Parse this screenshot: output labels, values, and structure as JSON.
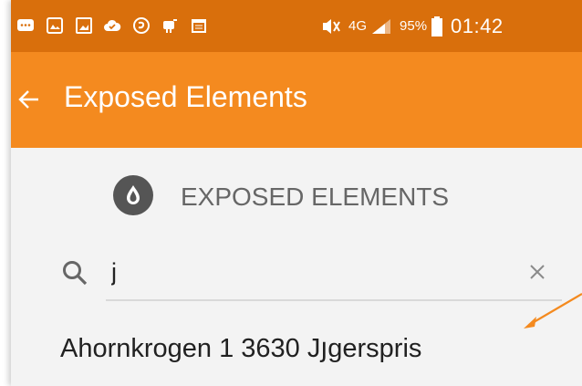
{
  "status_bar": {
    "network": "4G",
    "battery": "95%",
    "time": "01:42",
    "icons": [
      "chat-icon",
      "gallery-icon",
      "image-icon",
      "cloud-check-icon",
      "sync-icon",
      "android-debug-icon",
      "calendar-icon",
      "mute-icon",
      "signal-icon",
      "battery-icon"
    ]
  },
  "app_bar": {
    "back_icon": "back-arrow-icon",
    "title": "Exposed Elements"
  },
  "section": {
    "icon": "water-drop-icon",
    "title": "EXPOSED ELEMENTS"
  },
  "search": {
    "value": "j",
    "icon": "search-icon",
    "clear_icon": "close-icon"
  },
  "results": [
    {
      "label": "Ahornkrogen 1 3630 Jյgerspris"
    }
  ],
  "colors": {
    "status_bar": "#d96f0c",
    "app_bar": "#f48a1f",
    "background": "#f3f3f3",
    "annotation_arrow": "#f48a1f"
  }
}
